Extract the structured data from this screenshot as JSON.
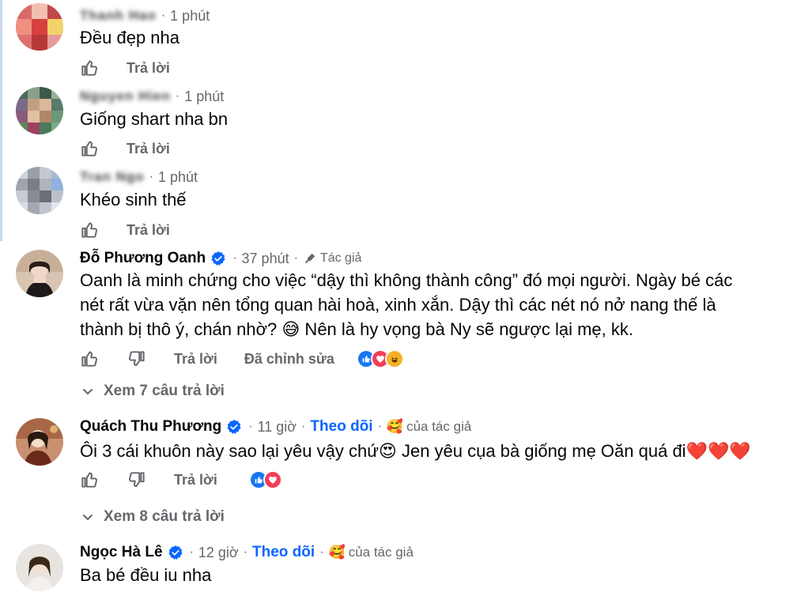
{
  "comments": [
    {
      "name": "Thanh Hao",
      "time": "1 phút",
      "text": "Đều đẹp nha",
      "actions": {
        "reply": "Trả lời"
      }
    },
    {
      "name": "Nguyen Hien",
      "time": "1 phút",
      "text": "Giống shart nha bn",
      "actions": {
        "reply": "Trả lời"
      }
    },
    {
      "name": "Tran Ngo",
      "time": "1 phút",
      "text": "Khéo sinh thế",
      "actions": {
        "reply": "Trả lời"
      }
    },
    {
      "name": "Đỗ Phương Oanh",
      "time": "37 phút",
      "author_badge": "Tác giả",
      "text_lines": [
        "Oanh là minh chứng cho việc “dậy thì không thành công” đó mọi người. Ngày bé các",
        "nét rất vừa vặn nên tổng quan hài hoà, xinh xắn. Dậy thì các nét nó nở nang thế là",
        "thành bị thô ý, chán nhờ? 😅 Nên là hy vọng bà Ny sẽ ngược lại mẹ, kk."
      ],
      "actions": {
        "reply": "Trả lời",
        "edited": "Đã chỉnh sửa"
      },
      "view_replies": "Xem 7 câu trả lời"
    },
    {
      "name": "Quách Thu Phương",
      "time": "11 giờ",
      "follow": "Theo dõi",
      "of_author": "của tác giả",
      "text": "Ôi 3 cái khuôn này sao lại yêu vậy chứ😍 Jen yêu cụa bà giống mẹ Oăn quá đi❤️❤️❤️",
      "actions": {
        "reply": "Trả lời"
      },
      "view_replies": "Xem 8 câu trả lời"
    },
    {
      "name": "Ngọc Hà Lê",
      "time": "12 giờ",
      "follow": "Theo dõi",
      "of_author": "của tác giả",
      "text": "Ba bé đều iu nha"
    }
  ],
  "colors": {
    "accent": "#0866ff",
    "secondary_text": "#65676b",
    "like": "#1877f2",
    "love": "#f33e58",
    "haha": "#f7b125"
  },
  "icons": {
    "like": "thumbs-up-icon",
    "dislike": "thumbs-down-icon",
    "verified": "verified-badge-icon",
    "author": "microphone-icon",
    "expand": "chevron-down-icon"
  }
}
